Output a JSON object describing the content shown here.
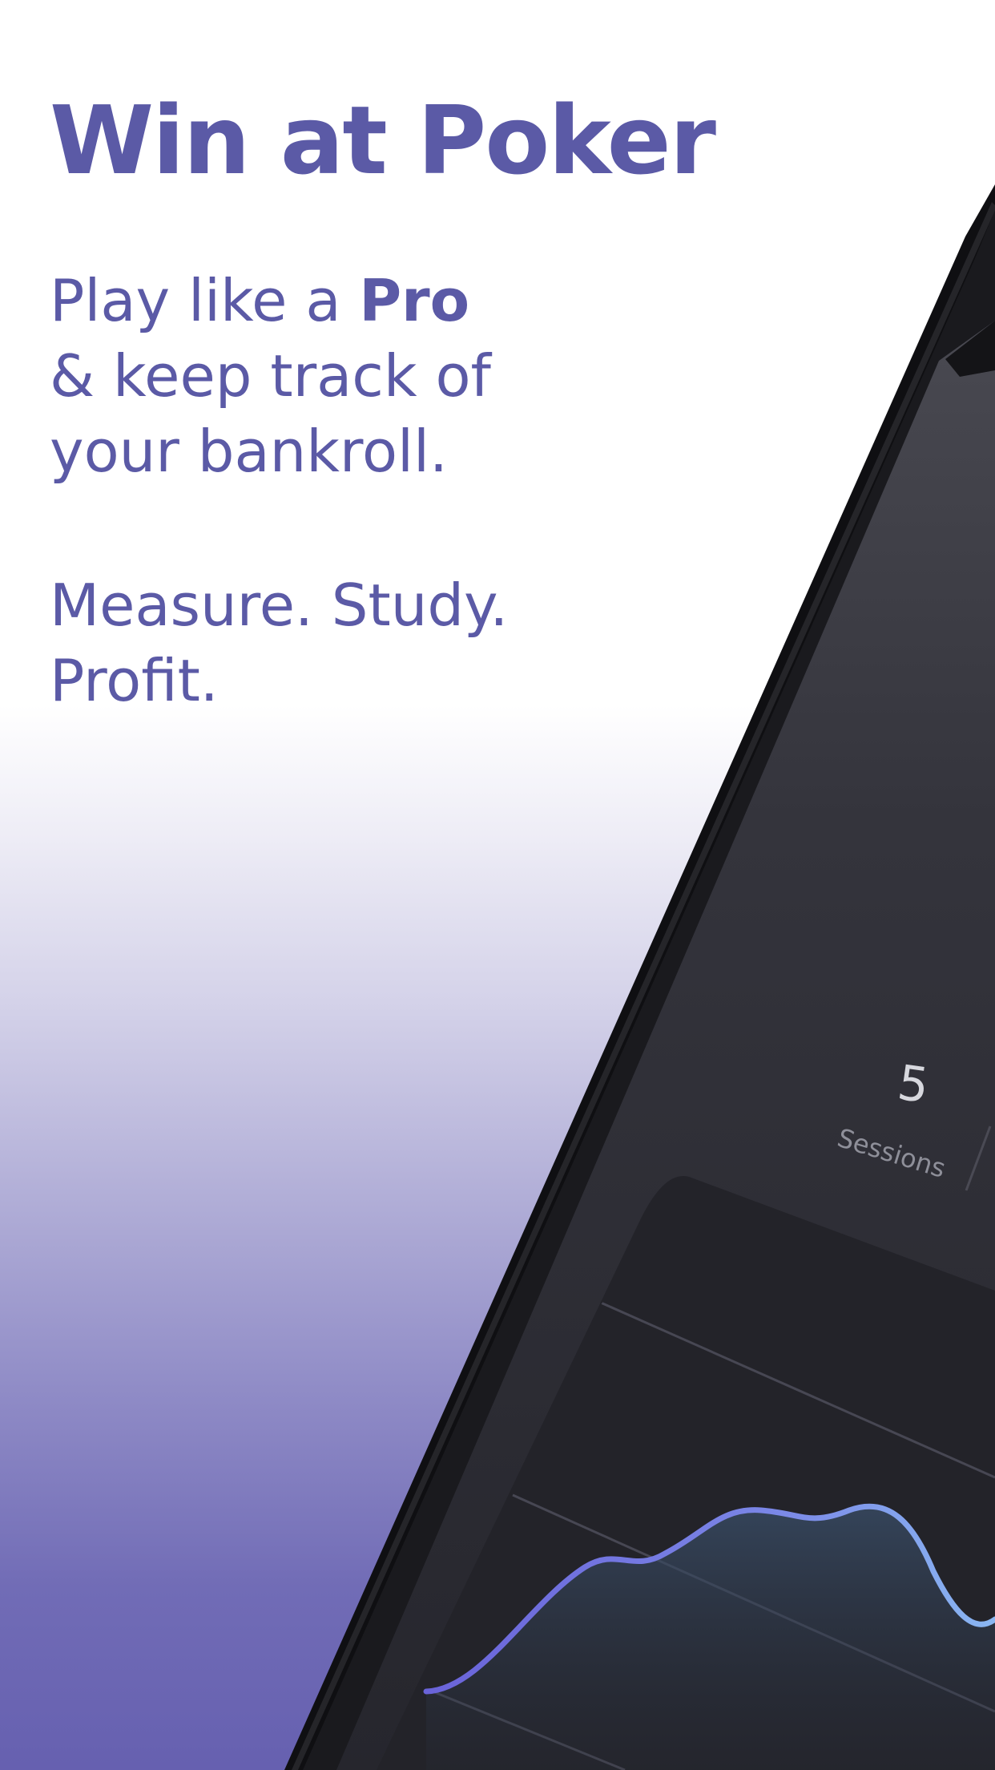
{
  "hero": {
    "headline": "Win at Poker",
    "tagline_prefix": "Play like a ",
    "tagline_bold": "Pro",
    "tagline_line2": "& keep track of",
    "tagline_line3": "your bankroll.",
    "motto_line1": "Measure. Study.",
    "motto_line2": "Profit."
  },
  "device_screen": {
    "stat": {
      "value": "5",
      "label": "Sessions"
    }
  },
  "colors": {
    "brand_text": "#5b5aa6",
    "screen_bg": "#2c2c34",
    "card_bg": "#222228",
    "chart_line_start": "#6a63d9",
    "chart_line_end": "#8ab7f2"
  }
}
